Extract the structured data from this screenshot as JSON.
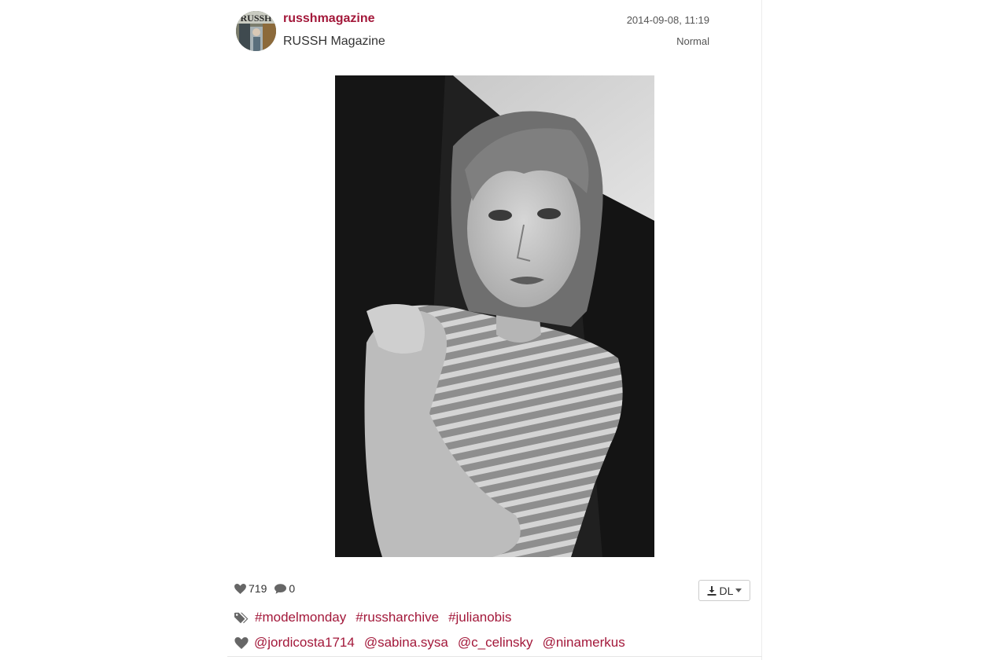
{
  "post": {
    "username": "russhmagazine",
    "full_name": "RUSSH Magazine",
    "timestamp": "2014-09-08, 11:19",
    "filter": "Normal",
    "avatar_label": "RUSSH",
    "likes": "719",
    "comments": "0"
  },
  "download": {
    "label": "DL"
  },
  "hashtags": [
    "#modelmonday",
    "#russharchive",
    "#julianobis"
  ],
  "mentions": [
    "@jordicosta1714",
    "@sabina.sysa",
    "@c_celinsky",
    "@ninamerkus"
  ],
  "icons": {
    "avatar": "magazine-cover-avatar",
    "likes": "heart-icon",
    "comments": "comment-bubble-icon",
    "download": "download-icon",
    "dropdown": "caret-down-icon",
    "tags": "tags-icon",
    "mentions": "heart-icon"
  },
  "colors": {
    "accent": "#a3183a",
    "text": "#333333",
    "muted": "#555555",
    "border": "#cccccc"
  }
}
